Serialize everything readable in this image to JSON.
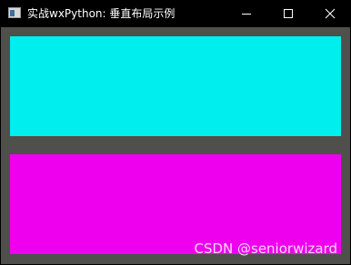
{
  "window": {
    "title": "实战wxPython: 垂直布局示例",
    "icon": "app-window-icon",
    "controls": [
      "minimize-icon",
      "maximize-icon",
      "close-icon"
    ]
  },
  "panels": [
    {
      "name": "top-panel",
      "color": "#00eeee"
    },
    {
      "name": "bottom-panel",
      "color": "#ee00ee"
    }
  ],
  "colors": {
    "titlebar": "#000000",
    "client_background": "#4f4f4b"
  },
  "watermark": {
    "text": "CSDN @seniorwizard"
  }
}
